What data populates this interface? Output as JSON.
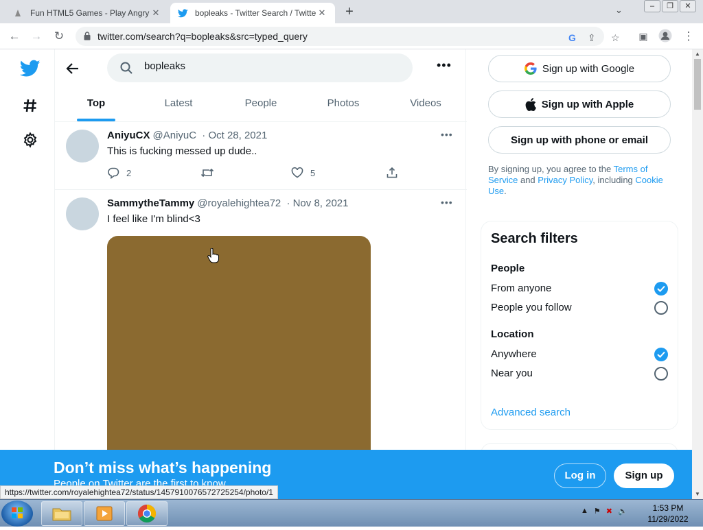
{
  "browser": {
    "tabs": [
      {
        "title": "Fun HTML5 Games - Play Angry",
        "active": false
      },
      {
        "title": "bopleaks - Twitter Search / Twitte",
        "active": true
      }
    ],
    "url": "twitter.com/search?q=bopleaks&src=typed_query",
    "status_url": "https://twitter.com/royalehightea72/status/1457910076572725254/photo/1"
  },
  "search": {
    "query": "bopleaks",
    "tabs": [
      {
        "label": "Top",
        "active": true
      },
      {
        "label": "Latest"
      },
      {
        "label": "People"
      },
      {
        "label": "Photos"
      },
      {
        "label": "Videos"
      }
    ]
  },
  "tweets": [
    {
      "name": "AniyuCX",
      "handle": "@AniyuC",
      "date": "· Oct 28, 2021",
      "text": "This is fucking messed up dude..",
      "replies": "2",
      "likes": "5"
    },
    {
      "name": "SammytheTammy",
      "handle": "@royalehightea72",
      "date": "· Nov 8, 2021",
      "text": "I feel like I'm blind<3"
    }
  ],
  "sidebar": {
    "signup_google": "Sign up with Google",
    "signup_apple": "Sign up with Apple",
    "signup_phone": "Sign up with phone or email",
    "terms_pre": "By signing up, you agree to the ",
    "terms_link": "Terms of Service",
    "terms_mid": " and ",
    "privacy_link": "Privacy Policy",
    "terms_post": ", including ",
    "cookie_link": "Cookie Use",
    "terms_end": ".",
    "filters_title": "Search filters",
    "people_label": "People",
    "from_anyone": "From anyone",
    "people_you_follow": "People you follow",
    "location_label": "Location",
    "anywhere": "Anywhere",
    "near_you": "Near you",
    "advanced": "Advanced search"
  },
  "banner": {
    "title": "Don’t miss what’s happening",
    "subtitle": "People on Twitter are the first to know.",
    "login": "Log in",
    "signup": "Sign up"
  },
  "taskbar": {
    "time": "1:53 PM",
    "date": "11/29/2022"
  },
  "colors": {
    "accent": "#1d9bf0",
    "media": "#8b6a30"
  }
}
